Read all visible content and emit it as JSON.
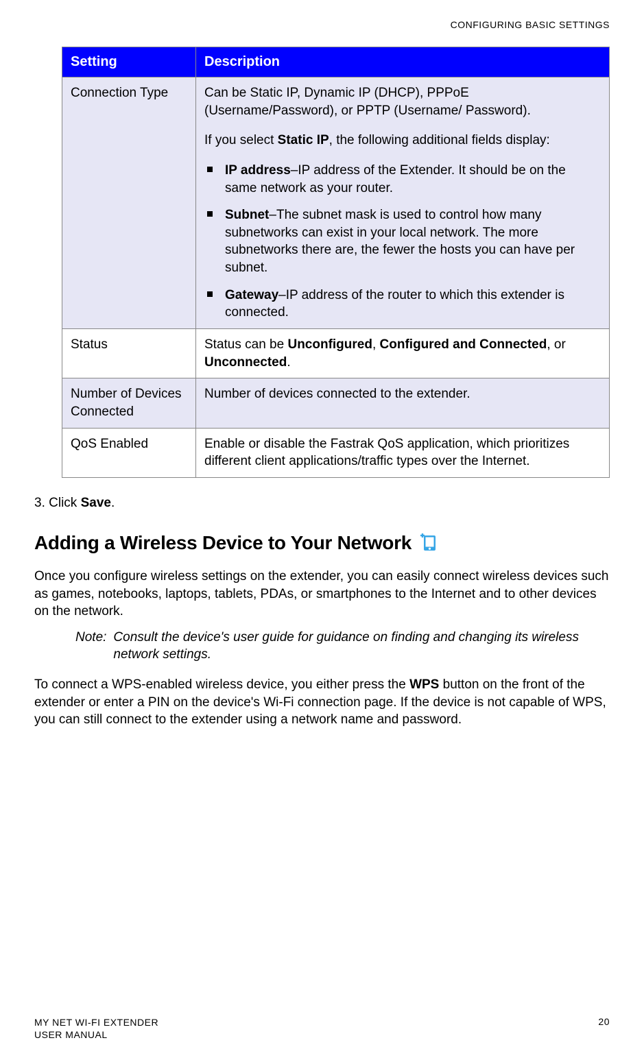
{
  "header": {
    "topic": "CONFIGURING BASIC SETTINGS"
  },
  "table": {
    "headers": {
      "setting": "Setting",
      "description": "Description"
    },
    "rows": {
      "connectionType": {
        "setting": "Connection Type",
        "intro": "Can be Static IP, Dynamic IP (DHCP), PPPoE (Username/Password), or PPTP (Username/ Password).",
        "staticNote_pre": "If you select ",
        "staticNote_bold": "Static IP",
        "staticNote_post": ", the following additional fields display:",
        "bullets": {
          "ip": {
            "label": "IP address",
            "text": "–IP address of the Extender. It should be on the same network as your router."
          },
          "subnet": {
            "label": "Subnet",
            "text": "–The subnet mask is used to control how many subnetworks can exist in your local network. The more subnetworks there are, the fewer the hosts you can have per subnet."
          },
          "gateway": {
            "label": "Gateway",
            "text": "–IP address of the router to which this extender is connected."
          }
        }
      },
      "status": {
        "setting": "Status",
        "desc_pre": "Status can be ",
        "desc_b1": "Unconfigured",
        "desc_mid1": ", ",
        "desc_b2": "Configured and Connected",
        "desc_mid2": ", or ",
        "desc_b3": "Unconnected",
        "desc_post": "."
      },
      "numDevices": {
        "setting": "Number of Devices Connected",
        "desc": "Number of devices connected to the extender."
      },
      "qos": {
        "setting": "QoS Enabled",
        "desc": "Enable or disable the Fastrak QoS application, which prioritizes different client applications/traffic types over the Internet."
      }
    }
  },
  "step3": {
    "num": "3.",
    "pre": "   Click ",
    "bold": "Save",
    "post": "."
  },
  "section": {
    "heading": "Adding a Wireless Device to Your Network",
    "para1": "Once you configure wireless settings on the extender, you can easily connect wireless devices such as games, notebooks, laptops, tablets, PDAs, or smartphones to the Internet and to other devices on the network.",
    "note": {
      "label": "Note:",
      "text": "Consult the device's user guide for guidance on finding and changing its wireless network settings."
    },
    "para2_pre": "To connect a WPS-enabled wireless device, you either press the ",
    "para2_bold": "WPS",
    "para2_post": " button on the front of the extender or enter a PIN on the device's Wi-Fi connection page. If the device is not capable of WPS, you can still connect to the extender using a network name and password."
  },
  "footer": {
    "line1": "MY NET WI-FI EXTENDER",
    "line2": "USER MANUAL",
    "page": "20"
  }
}
